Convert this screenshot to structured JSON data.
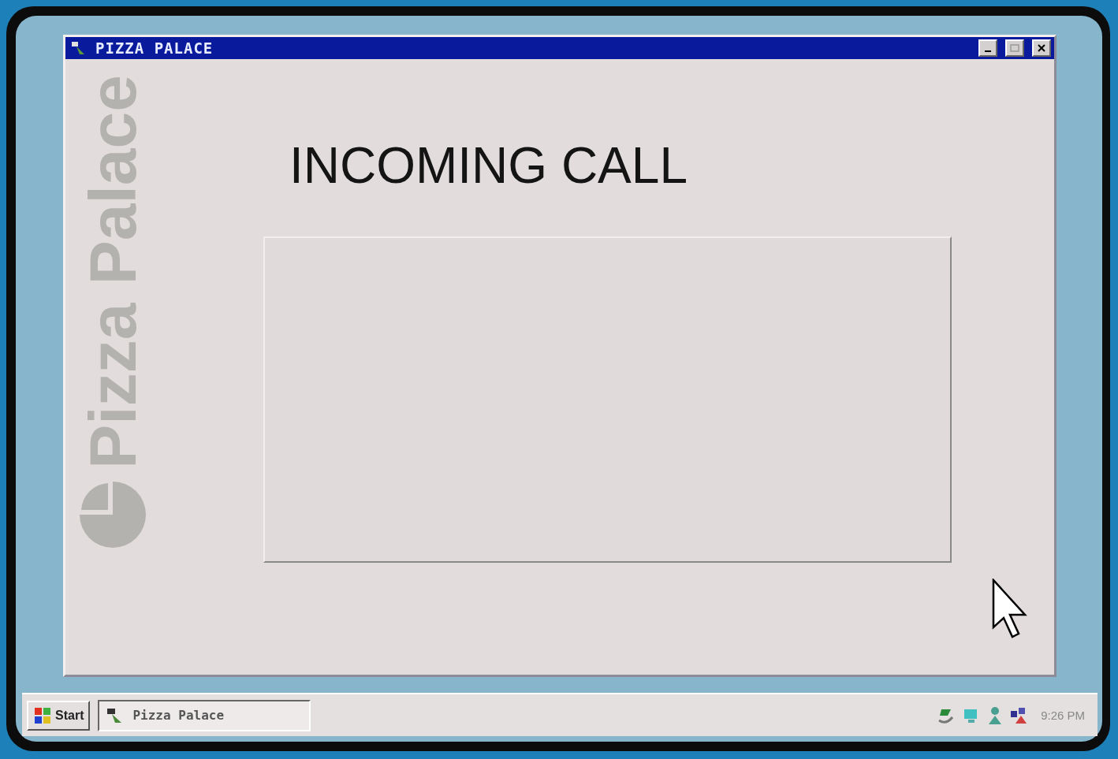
{
  "window": {
    "title": "PIZZA PALACE"
  },
  "logo": {
    "text": "Pizza Palace"
  },
  "heading": "INCOMING CALL",
  "taskbar": {
    "start": "Start",
    "tasks": [
      {
        "label": "Pizza Palace",
        "selected": true
      }
    ],
    "clock": "9:26 PM"
  }
}
